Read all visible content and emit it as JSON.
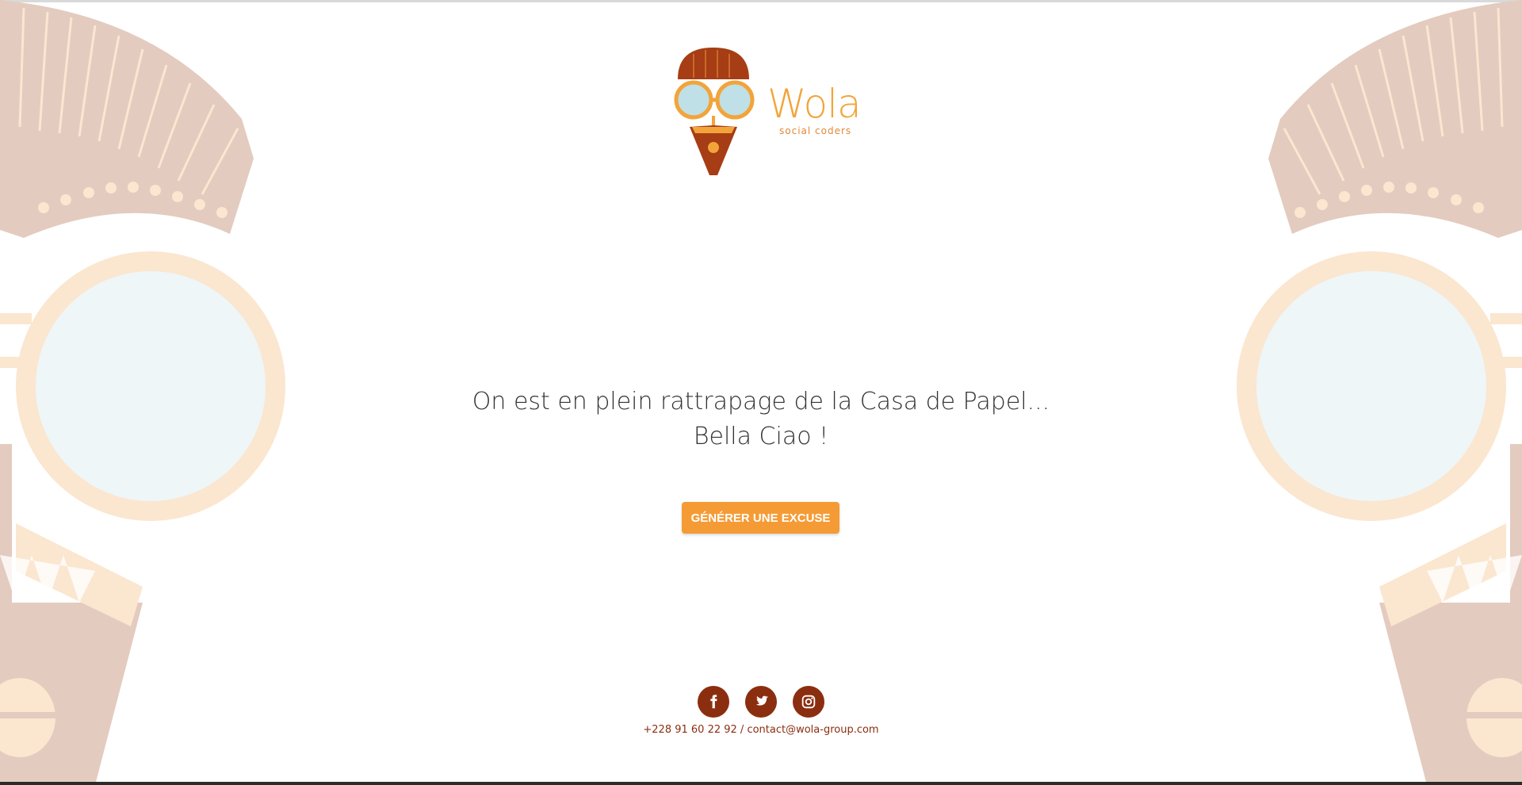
{
  "brand": {
    "name": "Wola",
    "tagline": "social coders"
  },
  "main": {
    "message": "On est en plein rattrapage de la Casa de Papel... Bella Ciao !",
    "button_label": "GÉNÉRER UNE EXCUSE"
  },
  "footer": {
    "social_icons": [
      "facebook-icon",
      "twitter-icon",
      "instagram-icon"
    ],
    "contact": "+228 91 60 22 92 / contact@wola-group.com"
  },
  "colors": {
    "accent": "#f59b35",
    "brown": "#8b2e10",
    "mask_tan": "#e3cbbf",
    "mask_cream": "#fbe6d0",
    "lens": "#eef6f8"
  }
}
